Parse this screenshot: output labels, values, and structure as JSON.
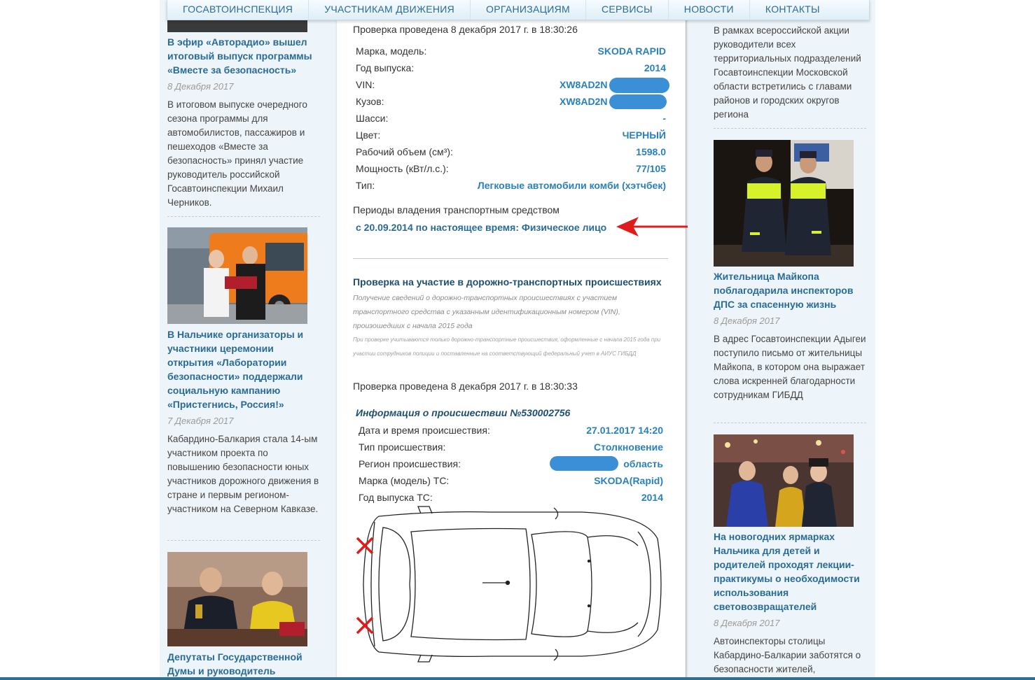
{
  "nav": {
    "items": [
      "Госавтоинспекция",
      "Участникам движения",
      "Организациям",
      "Сервисы",
      "Новости",
      "Контакты"
    ]
  },
  "left_news": [
    {
      "title": "В эфир «Авторадио» вышел итоговый выпуск программы «Вместе за безопасность»",
      "date": "8 Декабря 2017",
      "text": "В итоговом выпуске очередного сезона программы для автомобилистов, пассажиров и пешеходов «Вместе за безопасность» принял участие руководитель российской Госавтоинспекции Михаил Черников."
    },
    {
      "title": "В Нальчике организаторы и участники церемонии открытия «Лаборатории безопасности» поддержали социальную кампанию «Пристегнись, Россия!»",
      "date": "7 Декабря 2017",
      "text": "Кабардино-Балкария стала 14-ым участником проекта по повышению безопасности юных участников дорожного движения в стране и первым регионом-участником на Северном Кавказе."
    },
    {
      "title": "Депутаты Государственной Думы и руководитель"
    }
  ],
  "right_news": [
    {
      "text": "В рамках всероссийской акции руководители всех территориальных подразделений Госавтоинспекции Московской области встретились с главами районов и городских округов региона"
    },
    {
      "title": "Жительница Майкопа поблагодарила инспекторов ДПС за спасенную жизнь",
      "date": "8 Декабря 2017",
      "text": "В адрес Госавтоинспекции Адыгеи поступило письмо от жительницы Майкопа, в котором она выражает слова искренней благодарности сотрудникам ГИБДД"
    },
    {
      "title": "На новогодних ярмарках Нальчика для детей и родителей проходят лекции-практикумы о необходимости использования световозвращателей",
      "date": "8 Декабря 2017",
      "text": "Автоинспекторы столицы Кабардино-Балкарии заботятся о безопасности жителей,"
    }
  ],
  "vehicle_check": {
    "checked_at": "Проверка проведена 8 декабря 2017 г. в 18:30:26",
    "rows": [
      {
        "label": "Марка, модель:",
        "value": "SKODA RAPID"
      },
      {
        "label": "Год выпуска:",
        "value": "2014"
      },
      {
        "label": "VIN:",
        "value": "XW8AD2N"
      },
      {
        "label": "Кузов:",
        "value": "XW8AD2N"
      },
      {
        "label": "Шасси:",
        "value": "-"
      },
      {
        "label": "Цвет:",
        "value": "ЧЕРНЫЙ"
      },
      {
        "label": "Рабочий объем (см³):",
        "value": "1598.0"
      },
      {
        "label": "Мощность (кВт/л.с.):",
        "value": "77/105"
      },
      {
        "label": "Тип:",
        "value": "Легковые автомобили комби (хэтчбек)"
      }
    ],
    "ownership_heading": "Периоды владения транспортным средством",
    "ownership_period": "с 20.09.2014 по настоящее время: Физическое лицо"
  },
  "accident_check": {
    "heading": "Проверка на участие в дорожно-транспортных происшествиях",
    "description": "Получение сведений о дорожно-транспортных происшествиях с участием транспортного средства с указанным идентификационным номером (VIN), произошедших с начала 2015 года",
    "note": "При проверке учитываются только дорожно-транспортные происшествия, оформленные с начала 2015 года при участии сотрудников полиции и поставленные на соответствующий федеральный учет в АИУС ГИБДД",
    "checked_at": "Проверка проведена 8 декабря 2017 г. в 18:30:33",
    "incident_title": "Информация о происшествии №530002756",
    "rows": [
      {
        "label": "Дата и время происшествия:",
        "value": "27.01.2017 14:20"
      },
      {
        "label": "Тип происшествия:",
        "value": "Столкновение"
      },
      {
        "label": "Регион происшествия:",
        "value": "область"
      },
      {
        "label": "Марка (модель) ТС:",
        "value": "SKODA(Rapid)"
      },
      {
        "label": "Год выпуска ТС:",
        "value": "2014"
      }
    ]
  },
  "colors": {
    "link": "#2a6b96",
    "value": "#2a80b9",
    "arrow": "#e01b1b",
    "redaction": "#3a8fd6"
  }
}
